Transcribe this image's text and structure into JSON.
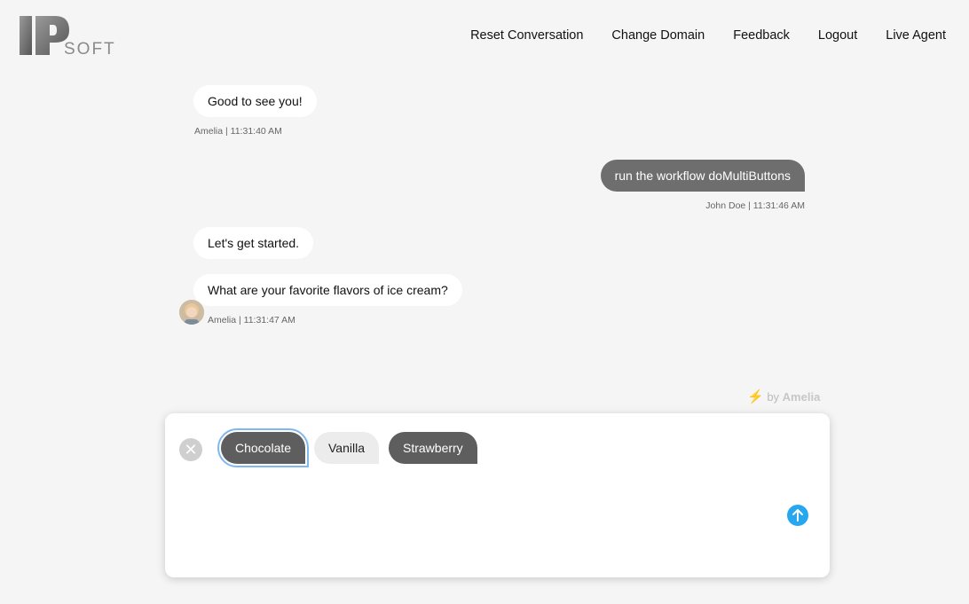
{
  "logo": {
    "text": "IPSOFT",
    "letters_big": "IP",
    "letters_small": "SOFT"
  },
  "nav": {
    "items": [
      "Reset Conversation",
      "Change Domain",
      "Feedback",
      "Logout",
      "Live Agent"
    ]
  },
  "messages": [
    {
      "sender": "Amelia",
      "text": "Good to see you!",
      "meta": "Amelia | 11:31:40 AM"
    },
    {
      "sender": "John Doe",
      "text": "run the workflow doMultiButtons",
      "meta": "John Doe | 11:31:46 AM"
    },
    {
      "sender": "Amelia",
      "text": "Let's get started."
    },
    {
      "sender": "Amelia",
      "text": "What are your favorite flavors of ice cream?",
      "meta": "Amelia | 11:31:47 AM"
    }
  ],
  "powered_by": {
    "prefix": "by",
    "name": "Amelia"
  },
  "options": [
    "Chocolate",
    "Vanilla",
    "Strawberry"
  ],
  "colors": {
    "accent": "#27a7ef",
    "user_bubble": "#6e6e6e",
    "button_dark": "#5e5e5e"
  }
}
